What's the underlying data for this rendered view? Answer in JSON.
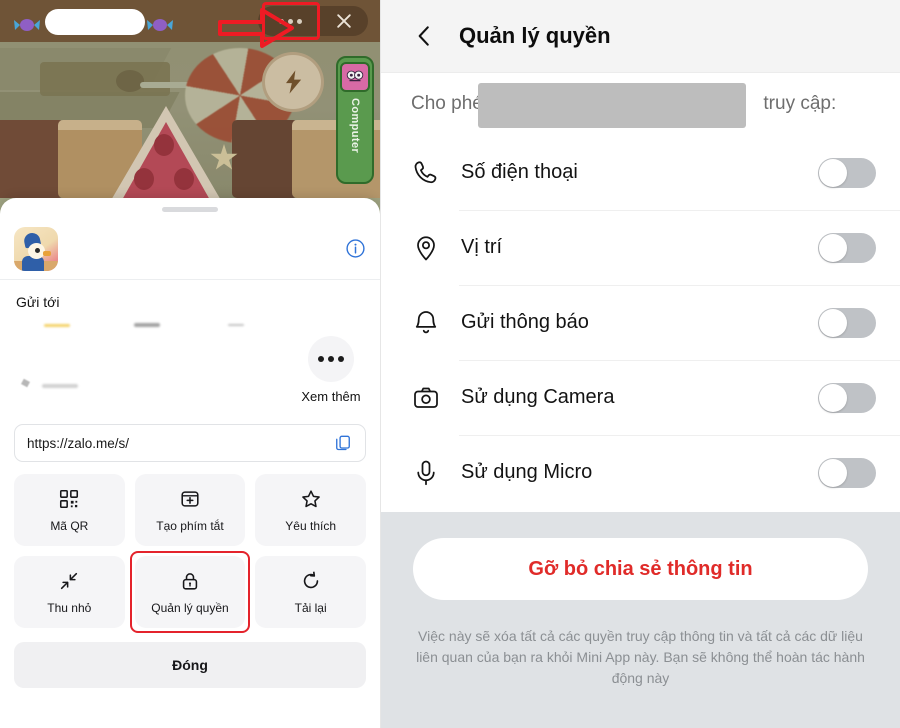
{
  "left_panel": {
    "topbar": {
      "app_name_redacted": "",
      "more_button": "more-options",
      "close_button": "close"
    },
    "side_widget": {
      "label": "Computer"
    },
    "sheet": {
      "app_name": "",
      "info_icon": "info-icon",
      "send_to_title": "Gửi tới",
      "more_label": "Xem thêm",
      "url": "https://zalo.me/s/",
      "copy_icon": "copy-icon",
      "tiles": [
        {
          "label": "Mã QR",
          "icon": "qr-code-icon",
          "selected": false
        },
        {
          "label": "Tạo phím tắt",
          "icon": "add-shortcut-icon",
          "selected": false
        },
        {
          "label": "Yêu thích",
          "icon": "star-icon",
          "selected": false
        },
        {
          "label": "Thu nhỏ",
          "icon": "minimize-icon",
          "selected": false
        },
        {
          "label": "Quản lý quyền",
          "icon": "lock-icon",
          "selected": true
        },
        {
          "label": "Tải lại",
          "icon": "reload-icon",
          "selected": false
        }
      ],
      "close_label": "Đóng"
    }
  },
  "right_panel": {
    "header": {
      "back_icon": "chevron-left-icon",
      "title": "Quản lý quyền"
    },
    "allow": {
      "prefix": "Cho phép",
      "app_name_redacted": "",
      "suffix": "truy cập:"
    },
    "permissions": [
      {
        "label": "Số điện thoại",
        "icon": "phone-icon",
        "enabled": false
      },
      {
        "label": "Vị trí",
        "icon": "location-pin-icon",
        "enabled": false
      },
      {
        "label": "Gửi thông báo",
        "icon": "bell-icon",
        "enabled": false
      },
      {
        "label": "Sử dụng Camera",
        "icon": "camera-icon",
        "enabled": false
      },
      {
        "label": "Sử dụng Micro",
        "icon": "microphone-icon",
        "enabled": false
      }
    ],
    "footer": {
      "danger_button": "Gỡ bỏ chia sẻ thông tin",
      "note": "Việc này sẽ xóa tất cả các quyền truy cập thông tin và tất cả các dữ liệu liên quan của bạn ra khỏi Mini App này. Bạn sẽ không thể hoàn tác hành động này"
    }
  },
  "colors": {
    "accent_red": "#e4232c",
    "danger_text": "#e02b29",
    "link_blue": "#2f73d8",
    "toggle_off": "#bfc2c6",
    "footer_bg": "#dfe2e5"
  }
}
